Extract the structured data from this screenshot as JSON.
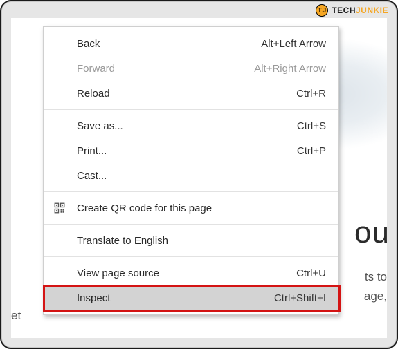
{
  "watermark": {
    "badge": "TJ",
    "text_prefix": "TECH",
    "text_accent": "JUNKIE"
  },
  "page_fragments": {
    "big": "ou",
    "line1": "ts to",
    "line2": "age,",
    "line3": "et"
  },
  "menu": {
    "groups": [
      [
        {
          "id": "back",
          "label": "Back",
          "accel": "Alt+Left Arrow",
          "disabled": false
        },
        {
          "id": "forward",
          "label": "Forward",
          "accel": "Alt+Right Arrow",
          "disabled": true
        },
        {
          "id": "reload",
          "label": "Reload",
          "accel": "Ctrl+R",
          "disabled": false
        }
      ],
      [
        {
          "id": "saveas",
          "label": "Save as...",
          "accel": "Ctrl+S"
        },
        {
          "id": "print",
          "label": "Print...",
          "accel": "Ctrl+P"
        },
        {
          "id": "cast",
          "label": "Cast...",
          "accel": ""
        }
      ],
      [
        {
          "id": "qr",
          "label": "Create QR code for this page",
          "accel": "",
          "icon": "qr-code-icon"
        }
      ],
      [
        {
          "id": "translate",
          "label": "Translate to English",
          "accel": ""
        }
      ],
      [
        {
          "id": "source",
          "label": "View page source",
          "accel": "Ctrl+U"
        },
        {
          "id": "inspect",
          "label": "Inspect",
          "accel": "Ctrl+Shift+I",
          "hover": true,
          "highlight": true
        }
      ]
    ]
  }
}
